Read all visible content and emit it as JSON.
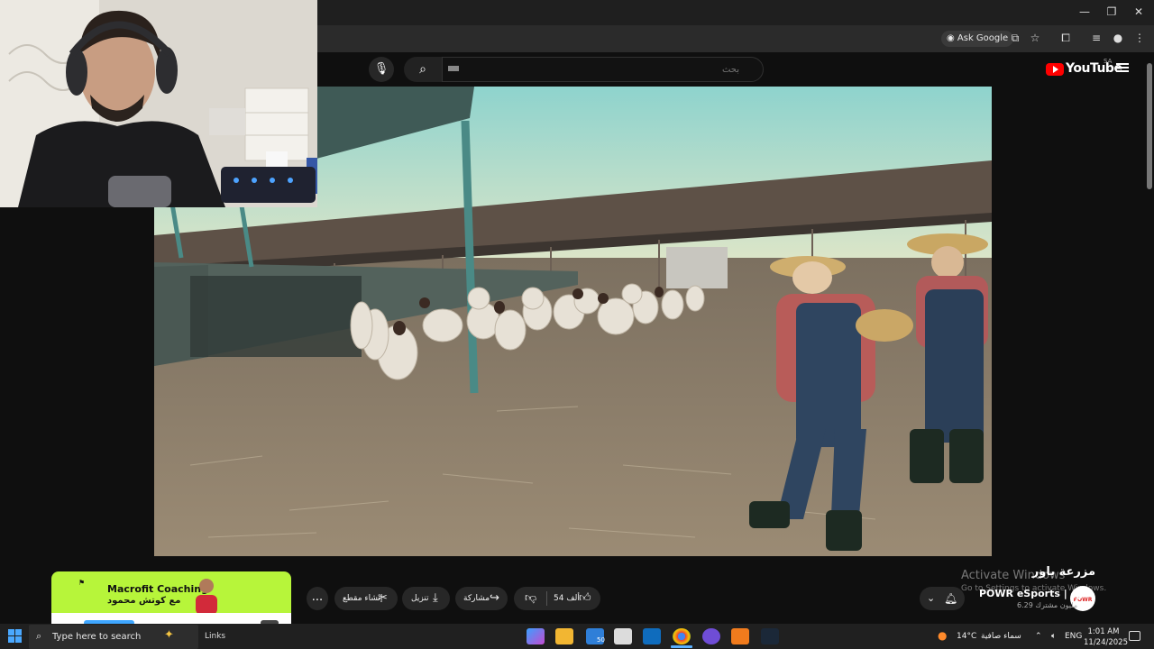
{
  "browser": {
    "ask_google": "Ask Google",
    "window_controls": [
      "—",
      "❐",
      "✕"
    ]
  },
  "youtube": {
    "search_placeholder": "بحث",
    "logo_text": "YouTube",
    "region": "SA"
  },
  "video": {
    "title": "مزرعة باور",
    "channel_name": "POWR eSports | باور",
    "subscribers": "6.29 مليون مشترك",
    "likes": "54 ألف",
    "share_label": "مشاركة",
    "download_label": "تنزيل",
    "clip_label": "إنشاء مقطع",
    "more_label": "..."
  },
  "watermark": {
    "line1": "Activate Windows",
    "line2": "Go to Settings to activate Windows."
  },
  "ad": {
    "title": "Macrofit Coaching",
    "subtitle": "مع كوتش محمود"
  },
  "taskbar": {
    "search_placeholder": "Type here to search",
    "links_label": "Links",
    "mail_badge": "50",
    "weather_temp": "14°C",
    "weather_text": "سماء صافية",
    "language": "ENG",
    "time": "1:01 AM",
    "date": "11/24/2025"
  },
  "colors": {
    "youtube_red": "#ff0000",
    "ad_green": "#b7f53a",
    "taskbar": "#202020",
    "page_bg": "#0f0f0f"
  }
}
